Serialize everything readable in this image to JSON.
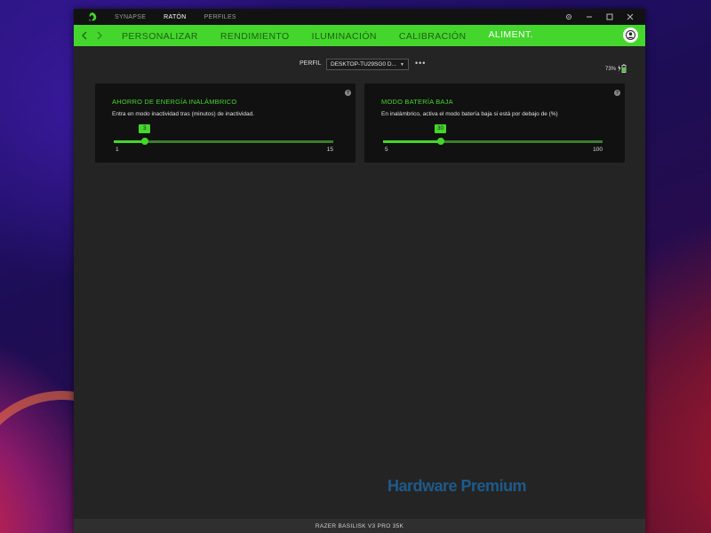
{
  "colors": {
    "accent": "#44d62c",
    "window_bg": "#242424",
    "card_bg": "#111111",
    "watermark": "#1e5a8a"
  },
  "topnav": {
    "items": [
      {
        "label": "SYNAPSE",
        "active": false
      },
      {
        "label": "RATÓN",
        "active": true
      },
      {
        "label": "PERFILES",
        "active": false
      }
    ]
  },
  "subnav": {
    "tabs": [
      {
        "label": "PERSONALIZAR",
        "active": false
      },
      {
        "label": "RENDIMIENTO",
        "active": false
      },
      {
        "label": "ILUMINACIÓN",
        "active": false
      },
      {
        "label": "CALIBRACIÓN",
        "active": false
      },
      {
        "label": "ALIMENT.",
        "active": true
      }
    ]
  },
  "profile": {
    "label": "PERFIL",
    "selected": "DESKTOP-TU29SG0 D..."
  },
  "battery": {
    "text": "73%",
    "level": 73
  },
  "cards": [
    {
      "title": "AHORRO DE ENERGÍA INALÁMBRICO",
      "description": "Entra en modo inactividad tras (minutos) de inactividad.",
      "min": 1,
      "max": 15,
      "value": 3,
      "min_label": "1",
      "max_label": "15",
      "value_label": "3"
    },
    {
      "title": "MODO BATERÍA BAJA",
      "description": "En inalámbrico, activa el modo batería baja si está por debajo de (%)",
      "min": 5,
      "max": 100,
      "value": 30,
      "min_label": "5",
      "max_label": "100",
      "value_label": "30"
    }
  ],
  "watermark": "Hardware Premium",
  "footer": {
    "device": "RAZER BASILISK V3 PRO 35K"
  }
}
